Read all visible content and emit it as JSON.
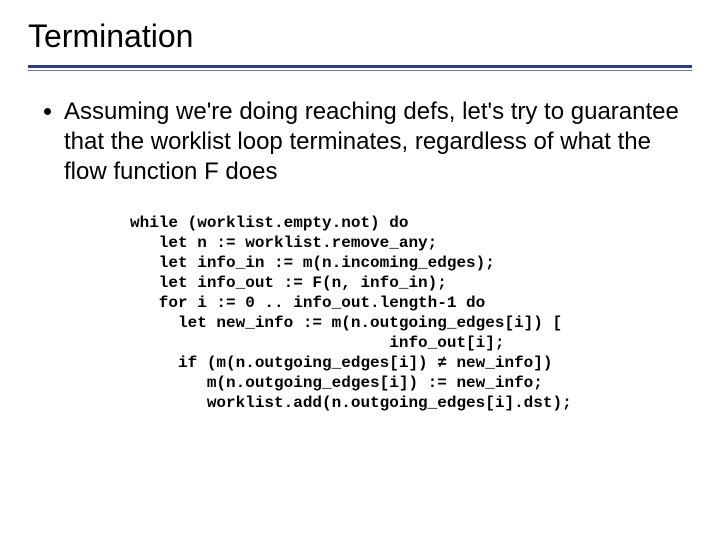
{
  "slide": {
    "title": "Termination",
    "bullet_text": "Assuming we're doing reaching defs, let's try to guarantee that the worklist loop terminates, regardless of what the flow function F does",
    "code_lines": [
      "while (worklist.empty.not) do",
      "   let n := worklist.remove_any;",
      "   let info_in := m(n.incoming_edges);",
      "   let info_out := F(n, info_in);",
      "   for i := 0 .. info_out.length-1 do",
      "     let new_info := m(n.outgoing_edges[i]) [",
      "                           info_out[i];",
      "     if (m(n.outgoing_edges[i]) ≠ new_info])",
      "        m(n.outgoing_edges[i]) := new_info;",
      "        worklist.add(n.outgoing_edges[i].dst);"
    ]
  }
}
